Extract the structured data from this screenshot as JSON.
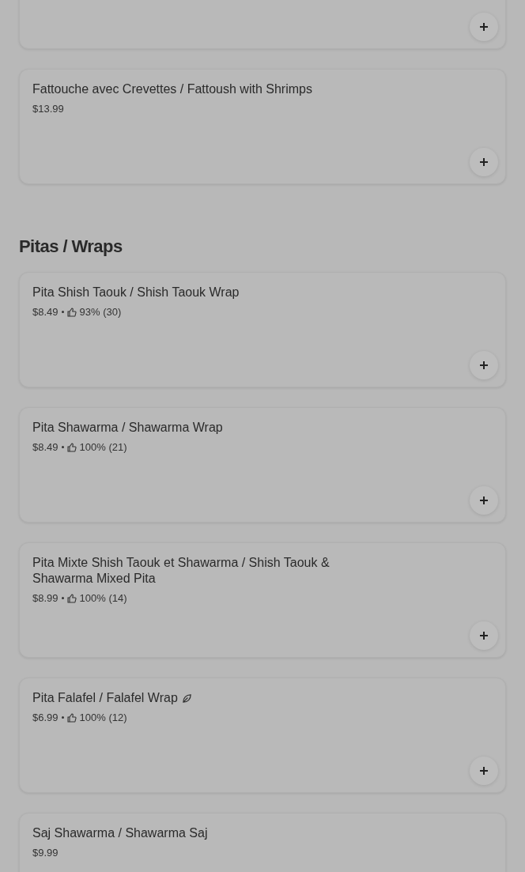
{
  "sections": [
    {
      "items": [
        {
          "kind": "cut"
        },
        {
          "kind": "item",
          "name": "Fattouche avec Crevettes / Fattoush with Shrimps",
          "price": "$13.99"
        }
      ]
    },
    {
      "heading": "Pitas / Wraps",
      "items": [
        {
          "kind": "item",
          "name": "Pita Shish Taouk / Shish Taouk Wrap",
          "price": "$8.49",
          "rating": "93% (30)"
        },
        {
          "kind": "item",
          "name": "Pita Shawarma / Shawarma Wrap",
          "price": "$8.49",
          "rating": "100% (21)"
        },
        {
          "kind": "item",
          "name": "Pita Mixte Shish Taouk et Shawarma / Shish Taouk & Shawarma Mixed Pita",
          "price": "$8.99",
          "rating": "100% (14)"
        },
        {
          "kind": "item",
          "name": "Pita Falafel / Falafel Wrap",
          "price": "$6.99",
          "rating": "100% (12)",
          "vegetarian": true
        },
        {
          "kind": "item",
          "name": "Saj Shawarma / Shawarma Saj",
          "price": "$9.99"
        }
      ]
    }
  ]
}
